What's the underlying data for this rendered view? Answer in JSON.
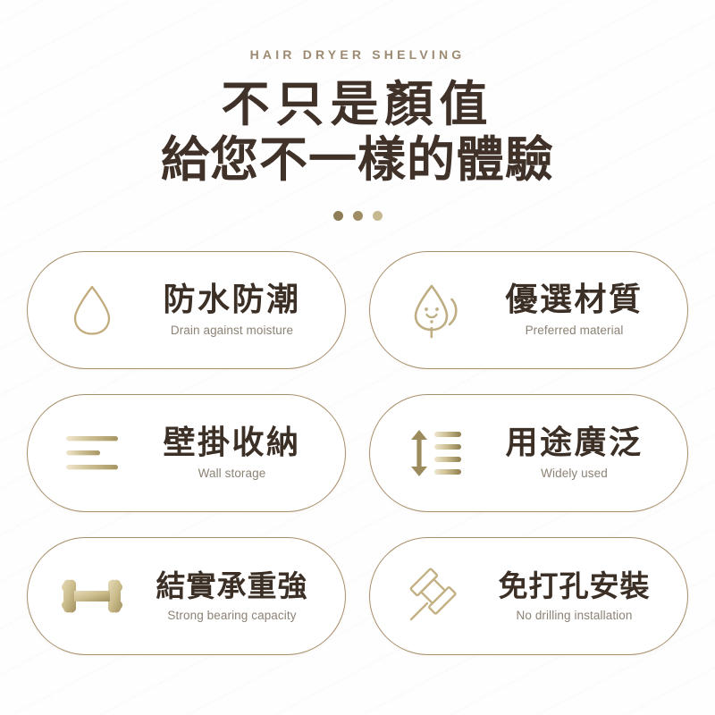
{
  "page": {
    "eyebrow": "HAIR DRYER SHELVING",
    "headline_line1": "不只是顏值",
    "headline_line2": "給您不一樣的體驗",
    "background_color": "#ffffff",
    "accent_gold": "#a98f6c",
    "headline_color": "#403229",
    "subtitle_color": "#8c8275"
  },
  "separator": {
    "dot_colors": [
      "#8d7c56",
      "#9d8c64",
      "#c6b88f"
    ]
  },
  "features": [
    {
      "icon": "water-drop-icon",
      "title": "防水防潮",
      "subtitle": "Drain against moisture"
    },
    {
      "icon": "smiling-leaf-icon",
      "title": "優選材質",
      "subtitle": "Preferred material"
    },
    {
      "icon": "stacked-lines-icon",
      "title": "壁掛收納",
      "subtitle": "Wall storage"
    },
    {
      "icon": "arrows-and-bars-icon",
      "title": "用途廣泛",
      "subtitle": "Widely used"
    },
    {
      "icon": "dumbbell-icon",
      "title": "結實承重強",
      "subtitle": "Strong bearing capacity"
    },
    {
      "icon": "push-pin-icon",
      "title": "免打孔安裝",
      "subtitle": "No drilling installation"
    }
  ]
}
